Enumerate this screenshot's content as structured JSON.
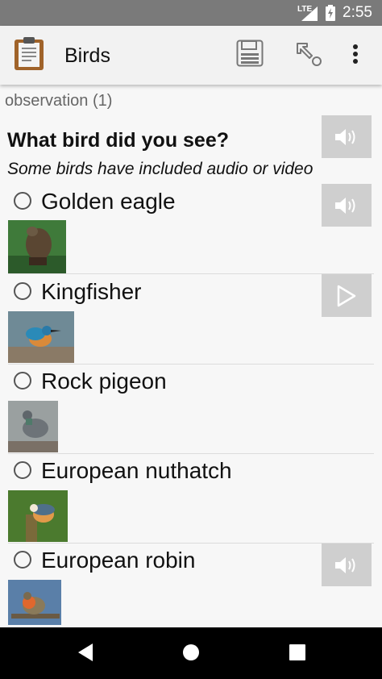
{
  "status_bar": {
    "network": "LTE",
    "time": "2:55"
  },
  "app_bar": {
    "title": "Birds"
  },
  "section": {
    "title": "observation (1)"
  },
  "question": {
    "label": "What bird did you see?",
    "hint": "Some birds have included audio or video"
  },
  "choices": [
    {
      "label": "Golden eagle",
      "media": "audio"
    },
    {
      "label": "Kingfisher",
      "media": "video"
    },
    {
      "label": "Rock pigeon",
      "media": "none"
    },
    {
      "label": "European nuthatch",
      "media": "none"
    },
    {
      "label": "European robin",
      "media": "audio"
    }
  ],
  "colors": {
    "status_bar": "#7a7a7a",
    "app_bar": "#f2f2f2",
    "media_button": "#cfcfcf",
    "nav_bar": "#000000"
  }
}
